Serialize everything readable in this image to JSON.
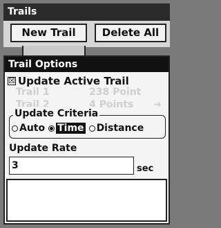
{
  "window": {
    "title": "Trails"
  },
  "buttons": {
    "new_trail": "New Trail",
    "delete_all": "Delete All"
  },
  "dialog": {
    "title": "Trail Options",
    "update_active_trail": {
      "label": "Update Active Trail",
      "checked": true,
      "mark": "☒"
    },
    "background_rows": [
      {
        "name": "Trail 1",
        "points": "238 Point",
        "arrow": ""
      },
      {
        "name": "Trail 2",
        "points": "4 Points",
        "arrow": "➔"
      }
    ],
    "update_criteria": {
      "legend": "Update Criteria",
      "options": [
        {
          "label": "Auto",
          "selected": false
        },
        {
          "label": "Time",
          "selected": true
        },
        {
          "label": "Distance",
          "selected": false
        }
      ]
    },
    "update_rate": {
      "label": "Update Rate",
      "value": "3",
      "unit": "sec"
    }
  }
}
